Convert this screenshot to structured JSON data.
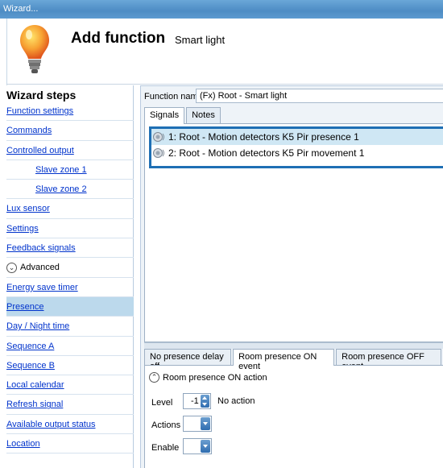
{
  "window": {
    "title": "Wizard..."
  },
  "header": {
    "title": "Add function",
    "subtitle": "Smart light"
  },
  "sidebar": {
    "title": "Wizard steps",
    "items": [
      {
        "label": "Function settings"
      },
      {
        "label": "Commands"
      },
      {
        "label": "Controlled output"
      },
      {
        "label": "Slave zone 1"
      },
      {
        "label": "Slave zone 2"
      },
      {
        "label": "Lux sensor"
      },
      {
        "label": "Settings"
      },
      {
        "label": "Feedback signals"
      },
      {
        "label": "Advanced"
      },
      {
        "label": "Energy save timer"
      },
      {
        "label": "Presence"
      },
      {
        "label": "Day / Night time"
      },
      {
        "label": "Sequence A"
      },
      {
        "label": "Sequence B"
      },
      {
        "label": "Local calendar"
      },
      {
        "label": "Refresh signal"
      },
      {
        "label": "Available output status"
      },
      {
        "label": "Location"
      }
    ],
    "selected": "Presence"
  },
  "function_name": {
    "label": "Function name:",
    "value": "(Fx) Root - Smart light"
  },
  "top_tabs": [
    {
      "label": "Signals"
    },
    {
      "label": "Notes"
    }
  ],
  "signals": [
    {
      "text": "1: Root - Motion detectors K5 Pir presence 1"
    },
    {
      "text": "2: Root - Motion detectors K5 Pir movement 1"
    }
  ],
  "bottom_tabs": [
    {
      "label": "No presence delay off"
    },
    {
      "label": "Room presence ON event"
    },
    {
      "label": "Room presence OFF event"
    }
  ],
  "event": {
    "section_title": "Room presence ON action",
    "level_label": "Level",
    "level_value": "-1",
    "level_text": "No action",
    "actions_label": "Actions",
    "enable_label": "Enable"
  },
  "colors": {
    "accent": "#1e6fb4",
    "selected_bg": "#bcd9ec",
    "link": "#0033cc"
  }
}
